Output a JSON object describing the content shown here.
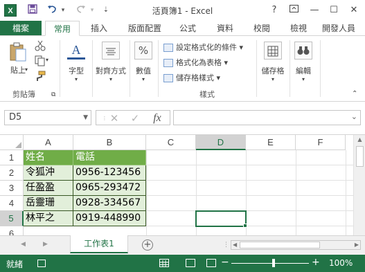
{
  "app": {
    "title": "活頁簿1 - Excel",
    "logo_letter": "X",
    "quick_access": [
      "save-icon",
      "undo-icon",
      "redo-icon",
      "customize-icon"
    ],
    "window_buttons": [
      "?",
      "restore",
      "—",
      "☐",
      "✕"
    ]
  },
  "tabs": {
    "file": "檔案",
    "items": [
      "常用",
      "插入",
      "版面配置",
      "公式",
      "資料",
      "校閱",
      "檢視",
      "開發人員"
    ],
    "active": "常用"
  },
  "ribbon": {
    "clipboard": {
      "paste": "貼上",
      "group_label": "剪貼簿"
    },
    "font": {
      "label": "字型"
    },
    "alignment": {
      "label": "對齊方式"
    },
    "number": {
      "label": "數值",
      "symbol": "%"
    },
    "styles": {
      "conditional": "設定格式化的條件",
      "as_table": "格式化為表格",
      "cell_styles": "儲存格樣式",
      "group_label": "樣式"
    },
    "cells": {
      "label": "儲存格"
    },
    "editing": {
      "label": "編輯"
    }
  },
  "formula_bar": {
    "name_box": "D5",
    "cancel_glyph": "✕",
    "enter_glyph": "✓",
    "fx_glyph": "fx",
    "formula": ""
  },
  "sheet": {
    "columns": [
      "A",
      "B",
      "C",
      "D",
      "E",
      "F"
    ],
    "rows": [
      "1",
      "2",
      "3",
      "4",
      "5",
      "6"
    ],
    "selected_column": "D",
    "selected_row": "5",
    "header_row": [
      "姓名",
      "電話"
    ],
    "data_rows": [
      [
        "令狐沖",
        "0956-123456"
      ],
      [
        "任盈盈",
        "0965-293472"
      ],
      [
        "岳靈珊",
        "0928-334567"
      ],
      [
        "林平之",
        "0919-448990"
      ]
    ],
    "table_colors": {
      "header": "#70ad47",
      "band": "#e2efda",
      "selection": "#217346"
    }
  },
  "sheet_tabs": {
    "active": "工作表1",
    "add_glyph": "+"
  },
  "status": {
    "ready": "就緒",
    "zoom": "100%",
    "zoom_minus": "−",
    "zoom_plus": "+"
  }
}
